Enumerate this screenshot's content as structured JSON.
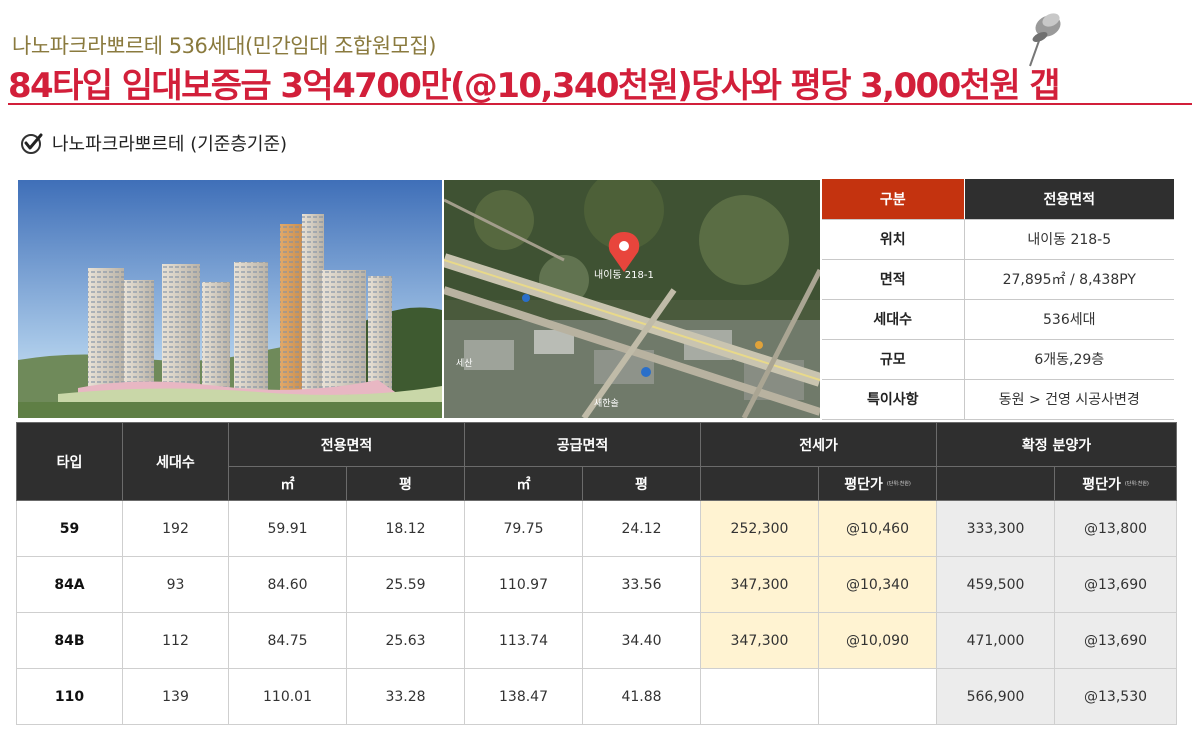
{
  "header": {
    "subtitle": "나노파크라뽀르테 536세대(민간임대 조합원모집)",
    "headline": "84타입 임대보증금 3억4700만(@10,340천원)당사와 평당 3,000천원 갭"
  },
  "section": {
    "title": "나노파크라뽀르테 (기준층기준)"
  },
  "map": {
    "pin_label": "내이동 218-1",
    "labels": [
      "세산",
      "새한솔"
    ]
  },
  "info_table": {
    "header": [
      "구분",
      "전용면적"
    ],
    "rows": [
      [
        "위치",
        "내이동 218-5"
      ],
      [
        "면적",
        "27,895㎡ / 8,438PY"
      ],
      [
        "세대수",
        "536세대"
      ],
      [
        "규모",
        "6개동,29층"
      ],
      [
        "특이사항",
        "동원 > 건영 시공사변경"
      ]
    ]
  },
  "price_table": {
    "headers": {
      "type": "타입",
      "households": "세대수",
      "exclusive_area": "전용면적",
      "supply_area": "공급면적",
      "jeonse": "전세가",
      "sale_price": "확정 분양가",
      "sqm": "㎡",
      "pyeong": "평",
      "per_pyeong": "평단가",
      "per_pyeong_note": "(단위:천원)"
    },
    "rows": [
      [
        "59",
        "192",
        "59.91",
        "18.12",
        "79.75",
        "24.12",
        "252,300",
        "@10,460",
        "333,300",
        "@13,800"
      ],
      [
        "84A",
        "93",
        "84.60",
        "25.59",
        "110.97",
        "33.56",
        "347,300",
        "@10,340",
        "459,500",
        "@13,690"
      ],
      [
        "84B",
        "112",
        "84.75",
        "25.63",
        "113.74",
        "34.40",
        "347,300",
        "@10,090",
        "471,000",
        "@13,690"
      ],
      [
        "110",
        "139",
        "110.01",
        "33.28",
        "138.47",
        "41.88",
        "",
        "",
        "566,900",
        "@13,530"
      ]
    ]
  },
  "colors": {
    "accent_red": "#d21f3a",
    "header_orange": "#c4330f",
    "header_dark": "#2f2f2f",
    "highlight_yellow": "#fff3d2",
    "highlight_gray": "#ececec"
  }
}
